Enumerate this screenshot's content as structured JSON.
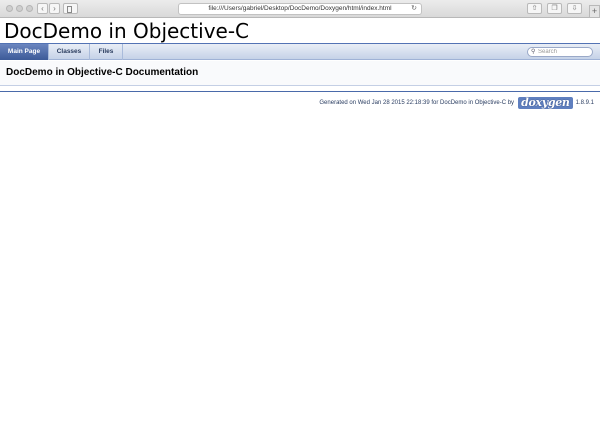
{
  "browser": {
    "url": "file:///Users/gabriel/Desktop/DocDemo/Doxygen/html/index.html",
    "icons": {
      "back": "chevron-left-icon",
      "forward": "chevron-right-icon",
      "sidebar": "sidebar-icon",
      "reload": "reload-icon",
      "share": "share-icon",
      "tabs": "tabs-icon",
      "downloads": "download-icon",
      "new_tab": "plus-icon"
    }
  },
  "project": {
    "title": "DocDemo in Objective-C"
  },
  "tabs": [
    {
      "label": "Main Page",
      "active": true
    },
    {
      "label": "Classes",
      "active": false
    },
    {
      "label": "Files",
      "active": false
    }
  ],
  "search": {
    "placeholder": "Search"
  },
  "page": {
    "heading": "DocDemo in Objective-C Documentation"
  },
  "footer": {
    "generated_text": "Generated on Wed Jan 28 2015 22:18:39 for DocDemo in Objective-C by",
    "logo_text": "doxygen",
    "version": "1.8.9.1"
  },
  "colors": {
    "accent": "#3c5a98",
    "tab_bar": "#c5d2e8",
    "logo": "#5f7fbf"
  }
}
